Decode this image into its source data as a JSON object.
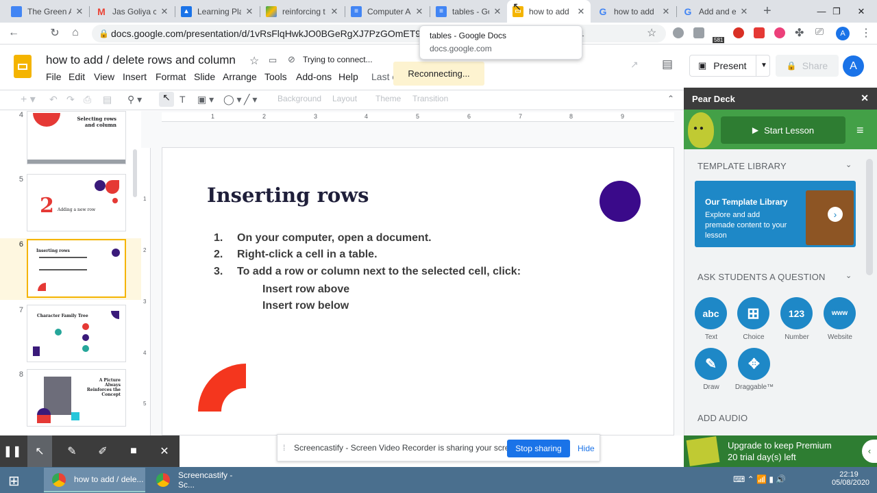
{
  "tabs": [
    {
      "title": "The Green A",
      "color": "#4285f4"
    },
    {
      "title": "Jas Goliya c",
      "color": "#ea4335"
    },
    {
      "title": "Learning Pla",
      "color": "#1a73e8"
    },
    {
      "title": "reinforcing t",
      "color": "#34a853"
    },
    {
      "title": "Computer A",
      "color": "#4285f4"
    },
    {
      "title": "tables - Goo",
      "color": "#4285f4"
    },
    {
      "title": "how to add",
      "color": "#f4b400"
    },
    {
      "title": "how to add",
      "color": "#4285f4"
    },
    {
      "title": "Add and ed",
      "color": "#4285f4"
    }
  ],
  "url": "docs.google.com/presentation/d/1vRsFlqHwkJO0BGeRgXJ7PzGOmET9zlWId-",
  "url_tail": "1",
  "tooltip": {
    "title": "tables - Google Docs",
    "domain": "docs.google.com"
  },
  "doc": {
    "title": "how to add / delete rows and column",
    "status": "Trying to connect...",
    "reconnecting": "Reconnecting..."
  },
  "menus": [
    "File",
    "Edit",
    "View",
    "Insert",
    "Format",
    "Slide",
    "Arrange",
    "Tools",
    "Add-ons",
    "Help"
  ],
  "last_edit": "Last e",
  "present_label": "Present",
  "share_label": "Share",
  "avatar": "A",
  "toolbar": {
    "background": "Background",
    "layout": "Layout",
    "theme": "Theme",
    "transition": "Transition"
  },
  "ruler_marks": [
    "1",
    "2",
    "3",
    "4",
    "5",
    "6",
    "7",
    "8",
    "9"
  ],
  "vruler_marks": [
    "1",
    "2",
    "3",
    "4",
    "5"
  ],
  "slides": [
    {
      "num": "4",
      "title": "Selecting rows and column"
    },
    {
      "num": "5",
      "title": "Adding a new row",
      "big": "2"
    },
    {
      "num": "6",
      "title": "Inserting rows"
    },
    {
      "num": "7",
      "title": "Character Family Tree"
    },
    {
      "num": "8",
      "title": "A Picture Always Reinforces the Concept"
    }
  ],
  "slide": {
    "title": "Inserting rows",
    "items": [
      {
        "n": "1.",
        "text": "On your computer, open a document."
      },
      {
        "n": "2.",
        "text": "Right-click a cell in a table."
      },
      {
        "n": "3.",
        "text": "To add a row or column next to the selected cell, click:"
      }
    ],
    "subitems": [
      "Insert row above",
      "Insert row below"
    ]
  },
  "peardeck": {
    "title": "Pear Deck",
    "start": "Start Lesson",
    "template_section": "TEMPLATE LIBRARY",
    "template_title": "Our Template Library",
    "template_desc": "Explore and add premade content to your lesson",
    "ask_section": "ASK STUDENTS A QUESTION",
    "question_types": [
      {
        "icon": "abc",
        "label": "Text"
      },
      {
        "icon": "grid",
        "label": "Choice"
      },
      {
        "icon": "123",
        "label": "Number"
      },
      {
        "icon": "www",
        "label": "Website"
      },
      {
        "icon": "pencil",
        "label": "Draw"
      },
      {
        "icon": "move",
        "label": "Draggable™"
      }
    ],
    "audio_section": "ADD AUDIO",
    "upgrade1": "Upgrade to keep Premium",
    "upgrade2": "20 trial day(s) left"
  },
  "screencastify": {
    "notice": "Screencastify - Screen Video Recorder is sharing your screen.",
    "stop": "Stop sharing",
    "hide": "Hide"
  },
  "taskbar": {
    "app1": "how to add / dele...",
    "app2": "Screencastify - Sc...",
    "time": "22:19",
    "date": "05/08/2020"
  }
}
